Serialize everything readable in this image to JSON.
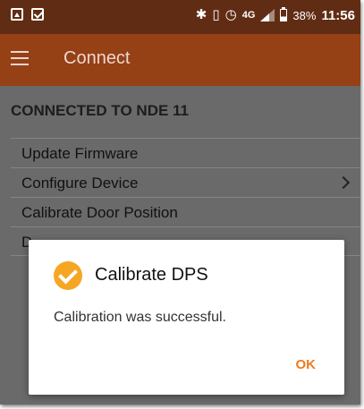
{
  "status_bar": {
    "left_icons": [
      "image-icon",
      "check-box-icon"
    ],
    "right_icons": [
      "bluetooth-icon",
      "vibrate-icon",
      "alarm-icon",
      "4g-icon",
      "signal-icon",
      "battery-icon"
    ],
    "network_label": "4G",
    "battery_percent": "38%",
    "time": "11:56"
  },
  "toolbar": {
    "title": "Connect",
    "menu_icon": "hamburger-menu-icon"
  },
  "main": {
    "section_header": "CONNECTED TO NDE 11",
    "items": [
      {
        "label": "Update Firmware",
        "has_chevron": false
      },
      {
        "label": "Configure Device",
        "has_chevron": true
      },
      {
        "label": "Calibrate Door Position",
        "has_chevron": false
      },
      {
        "label": "D",
        "has_chevron": false
      }
    ]
  },
  "dialog": {
    "icon": "check-circle-icon",
    "title": "Calibrate DPS",
    "message": "Calibration was successful.",
    "ok_label": "OK"
  },
  "colors": {
    "status_bar": "#602d14",
    "toolbar": "#964016",
    "dialog_icon": "#f5a623",
    "ok_button": "#f07a1c"
  }
}
